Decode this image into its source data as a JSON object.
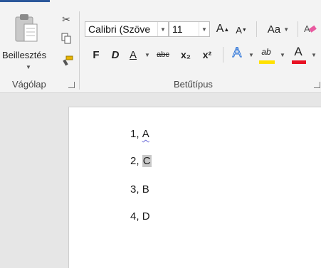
{
  "clipboard": {
    "paste_label": "Beillesztés",
    "group_label": "Vágólap"
  },
  "font": {
    "font_name": "Calibri (Szöve",
    "font_size": "11",
    "group_label": "Betűtípus",
    "grow_font": "A",
    "shrink_font": "A",
    "change_case": "Aa",
    "bold": "F",
    "italic": "D",
    "underline": "A",
    "strikethrough": "abc",
    "subscript": "x₂",
    "superscript": "x²",
    "text_effects": "A",
    "highlight": "ab",
    "font_color": "A"
  },
  "document": {
    "lines": [
      {
        "number": "1,",
        "answer": "A"
      },
      {
        "number": "2,",
        "answer": "C"
      },
      {
        "number": "3,",
        "answer": "B"
      },
      {
        "number": "4,",
        "answer": "D"
      }
    ]
  },
  "colors": {
    "accent": "#2b579a",
    "highlight_bar": "#ffe100",
    "font_color_bar": "#e81123"
  }
}
